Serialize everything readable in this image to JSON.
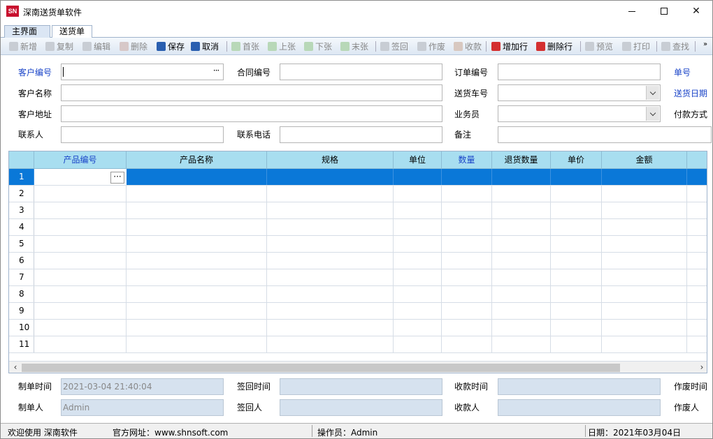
{
  "window": {
    "logo_text": "SN",
    "title": "深南送货单软件",
    "close_glyph": "✕"
  },
  "tabs": [
    {
      "label": "主界面"
    },
    {
      "label": "送货单"
    }
  ],
  "toolbar": {
    "items": [
      {
        "label": "新增",
        "icon": "new-doc-icon",
        "enabled": false
      },
      {
        "label": "复制",
        "icon": "copy-icon",
        "enabled": false
      },
      {
        "label": "编辑",
        "icon": "edit-icon",
        "enabled": false
      },
      {
        "label": "删除",
        "icon": "delete-icon",
        "enabled": false
      },
      {
        "label": "保存",
        "icon": "save-icon",
        "enabled": true
      },
      {
        "label": "取消",
        "icon": "undo-icon",
        "enabled": true
      },
      {
        "label": "首张",
        "icon": "first-icon",
        "enabled": false
      },
      {
        "label": "上张",
        "icon": "prev-icon",
        "enabled": false
      },
      {
        "label": "下张",
        "icon": "next-icon",
        "enabled": false
      },
      {
        "label": "末张",
        "icon": "last-icon",
        "enabled": false
      },
      {
        "label": "签回",
        "icon": "sign-icon",
        "enabled": false
      },
      {
        "label": "作废",
        "icon": "void-icon",
        "enabled": false
      },
      {
        "label": "收款",
        "icon": "payment-icon",
        "enabled": false
      },
      {
        "label": "增加行",
        "icon": "add-row-icon",
        "enabled": true
      },
      {
        "label": "删除行",
        "icon": "delete-row-icon",
        "enabled": true
      },
      {
        "label": "预览",
        "icon": "preview-icon",
        "enabled": false
      },
      {
        "label": "打印",
        "icon": "print-icon",
        "enabled": false
      },
      {
        "label": "查找",
        "icon": "find-icon",
        "enabled": false
      }
    ],
    "more_glyph": "»"
  },
  "form": {
    "customer_code": {
      "label": "客户编号",
      "value": "",
      "dots": "···"
    },
    "contract_no": {
      "label": "合同编号",
      "value": ""
    },
    "order_no": {
      "label": "订单编号",
      "value": ""
    },
    "doc_no": {
      "label": "单号"
    },
    "customer_name": {
      "label": "客户名称",
      "value": ""
    },
    "vehicle_no": {
      "label": "送货车号",
      "value": ""
    },
    "delivery_date": {
      "label": "送货日期"
    },
    "customer_address": {
      "label": "客户地址",
      "value": ""
    },
    "salesperson": {
      "label": "业务员",
      "value": ""
    },
    "payment_method": {
      "label": "付款方式"
    },
    "contact": {
      "label": "联系人",
      "value": ""
    },
    "contact_phone": {
      "label": "联系电话",
      "value": ""
    },
    "remark": {
      "label": "备注",
      "value": ""
    }
  },
  "grid": {
    "columns": [
      {
        "label": "产品编号",
        "highlight": true
      },
      {
        "label": "产品名称",
        "highlight": false
      },
      {
        "label": "规格",
        "highlight": false
      },
      {
        "label": "单位",
        "highlight": false
      },
      {
        "label": "数量",
        "highlight": true
      },
      {
        "label": "退货数量",
        "highlight": false
      },
      {
        "label": "单价",
        "highlight": false
      },
      {
        "label": "金额",
        "highlight": false
      }
    ],
    "row_numbers": [
      "1",
      "2",
      "3",
      "4",
      "5",
      "6",
      "7",
      "8",
      "9",
      "10",
      "11"
    ],
    "selected_row": 1,
    "cell_dots": "···",
    "scroll_left": "‹",
    "scroll_right": "›"
  },
  "footer": {
    "created_time": {
      "label": "制单时间",
      "value": "2021-03-04 21:40:04"
    },
    "signed_time": {
      "label": "签回时间",
      "value": ""
    },
    "payment_time": {
      "label": "收款时间",
      "value": ""
    },
    "void_time": {
      "label": "作废时间"
    },
    "creator": {
      "label": "制单人",
      "value": "Admin"
    },
    "signer": {
      "label": "签回人",
      "value": ""
    },
    "payee": {
      "label": "收款人",
      "value": ""
    },
    "voider": {
      "label": "作废人"
    }
  },
  "status": {
    "welcome": "欢迎使用 深南软件",
    "website": "官方网址：www.shnsoft.com",
    "operator": "操作员：Admin",
    "date": "日期：2021年03月04日"
  },
  "colors": {
    "accent_blue": "#1a44c8",
    "selection": "#0a78d8",
    "grid_header": "#a8def0",
    "readonly_field": "#d6e2ef"
  }
}
